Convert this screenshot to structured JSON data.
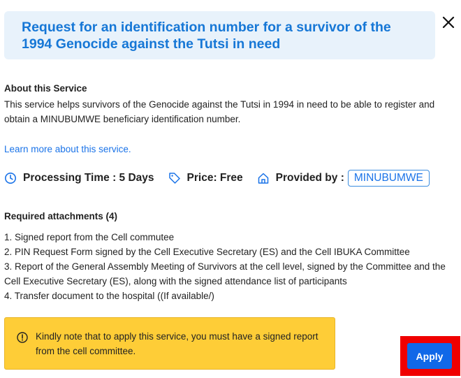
{
  "dialog": {
    "title": "Request for an identification number for a survivor of the 1994 Genocide against the Tutsi in need",
    "close_icon": "close-icon"
  },
  "about": {
    "heading": "About this Service",
    "description": "This service helps survivors of the Genocide against the Tutsi in 1994 in need to be able to register and obtain a MINUBUMWE beneficiary identification number.",
    "learn_more": "Learn more about this service."
  },
  "meta": {
    "processing_time": "Processing Time : 5 Days",
    "price": "Price: Free",
    "provided_by_label": "Provided by :",
    "provider": "MINUBUMWE",
    "icons": [
      "clock-icon",
      "tag-icon",
      "home-icon"
    ]
  },
  "attachments": {
    "heading": "Required attachments (4)",
    "items": [
      "1. Signed report from the Cell commutee",
      "2. PIN Request Form signed by the Cell Executive Secretary (ES) and the Cell IBUKA Committee",
      "3. Report of the General Assembly Meeting of Survivors at the cell level, signed by the Committee and the Cell Executive Secretary (ES), along with the signed attendance list of participants",
      "4. Transfer document to the hospital ((If available/)"
    ]
  },
  "notice": {
    "text": "Kindly note that to apply this service, you must have a signed report from the cell committee.",
    "icon": "alert-circle-icon"
  },
  "actions": {
    "apply_label": "Apply"
  },
  "colors": {
    "accent": "#1677d6",
    "header_bg": "#e8f2fb",
    "notice_bg": "#fecd37",
    "apply_bg": "#1068e8",
    "highlight": "#f00000"
  }
}
